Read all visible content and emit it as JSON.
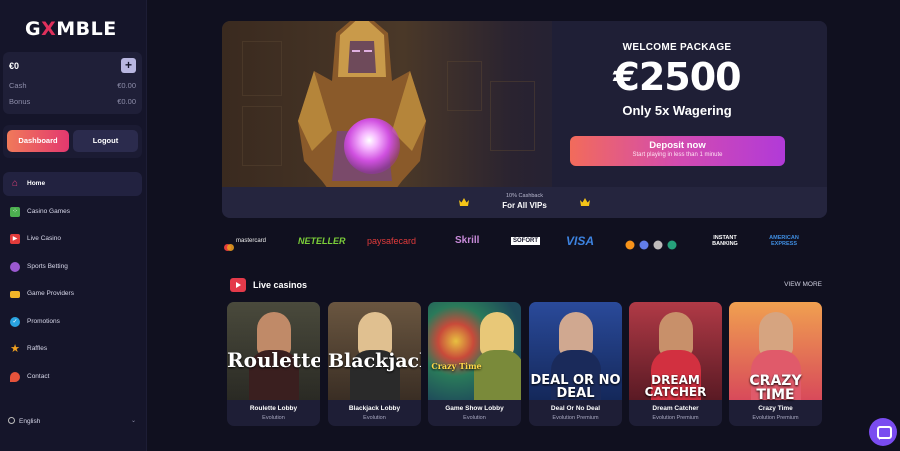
{
  "brand": {
    "logo_pre": "G",
    "logo_x": "X",
    "logo_post": "MBLE"
  },
  "wallet": {
    "balance": "€0",
    "plus": "+",
    "cash_label": "Cash",
    "cash_value": "€0.00",
    "bonus_label": "Bonus",
    "bonus_value": "€0.00"
  },
  "account": {
    "dashboard": "Dashboard",
    "logout": "Logout"
  },
  "nav": {
    "items": [
      {
        "label": "Home",
        "icon": "home-icon",
        "color": "#e0407a"
      },
      {
        "label": "Casino Games",
        "icon": "dice-icon",
        "color": "#4caf50"
      },
      {
        "label": "Live Casino",
        "icon": "play-icon",
        "color": "#e23b3b"
      },
      {
        "label": "Sports Betting",
        "icon": "ball-icon",
        "color": "#9b59d0"
      },
      {
        "label": "Game Providers",
        "icon": "gamepad-icon",
        "color": "#f0b429"
      },
      {
        "label": "Promotions",
        "icon": "badge-icon",
        "color": "#29a3e0"
      },
      {
        "label": "Raffles",
        "icon": "star-icon",
        "color": "#f0a020"
      },
      {
        "label": "Contact",
        "icon": "chat-icon",
        "color": "#e5533b"
      }
    ]
  },
  "language": {
    "label": "English"
  },
  "hero": {
    "welcome": "WELCOME PACKAGE",
    "amount": "€2500",
    "wagering": "Only 5x Wagering",
    "deposit": "Deposit now",
    "deposit_sub": "Start playing in less than 1 minute",
    "cashback_small": "10% Cashback",
    "cashback_big": "For All VIPs"
  },
  "payments": [
    {
      "label": "mastercard",
      "color": "#f0f0f0"
    },
    {
      "label": "NETELLER",
      "color": "#7ccf3a"
    },
    {
      "label": "paysafecard",
      "color": "#e23b3b"
    },
    {
      "label": "Skrill",
      "color": "#c78ad8"
    },
    {
      "label": "SOFORT",
      "color": "#ffffff"
    },
    {
      "label": "VISA",
      "color": "#3d83e0"
    },
    {
      "label": "INSTANT BANKING",
      "color": "#ffffff"
    },
    {
      "label": "AMERICAN EXPRESS",
      "color": "#3f8de0"
    }
  ],
  "live": {
    "title": "Live casinos",
    "view_more": "VIEW MORE",
    "cards": [
      {
        "word": "Roulette",
        "name": "Roulette Lobby",
        "provider": "Evolution",
        "bg": "#3a3a30",
        "accent": "#c08a68"
      },
      {
        "word": "Blackjack",
        "name": "Blackjack Lobby",
        "provider": "Evolution",
        "bg": "#5a4a38",
        "accent": "#d4b090"
      },
      {
        "word": "Crazy Time",
        "name": "Game Show Lobby",
        "provider": "Evolution",
        "bg": "#2d6a58",
        "accent": "#e8c878"
      },
      {
        "word": "DEAL OR NO DEAL",
        "name": "Deal Or No Deal",
        "provider": "Evolution Premium",
        "bg": "#1e3f86",
        "accent": "#d0a890"
      },
      {
        "word": "DREAM CATCHER",
        "name": "Dream Catcher",
        "provider": "Evolution Premium",
        "bg": "#8a2a36",
        "accent": "#c8906a"
      },
      {
        "word": "CRAZY TIME",
        "name": "Crazy Time",
        "provider": "Evolution Premium",
        "bg": "#d04e5c",
        "accent": "#d6a480"
      }
    ]
  }
}
